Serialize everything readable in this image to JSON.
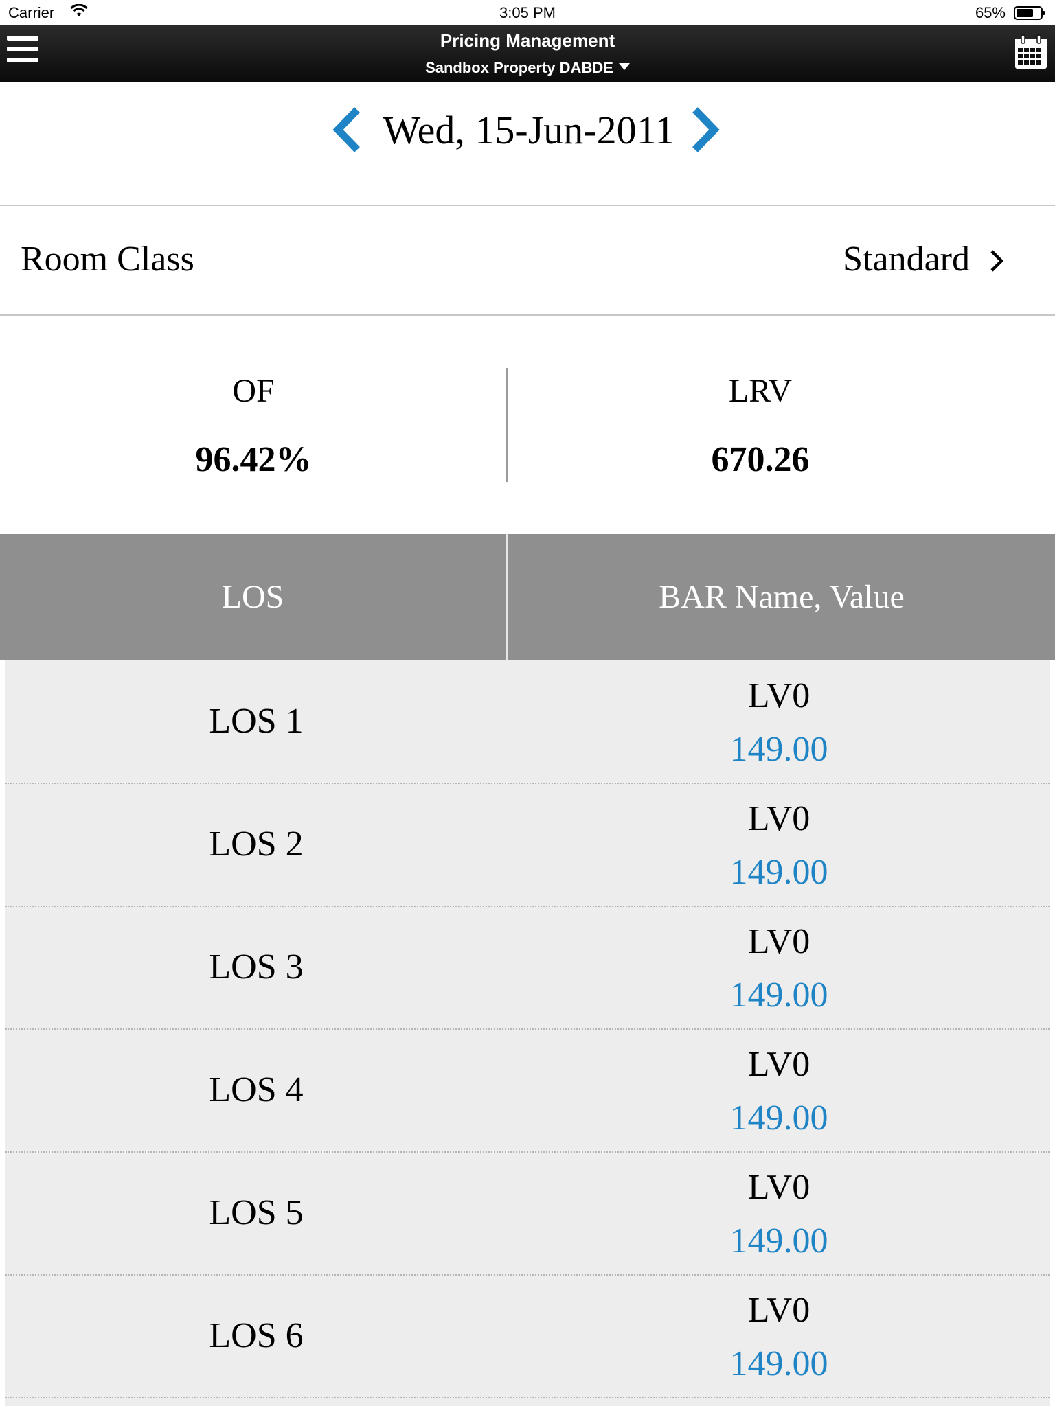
{
  "status_bar": {
    "carrier": "Carrier",
    "time": "3:05 PM",
    "battery": "65%"
  },
  "nav": {
    "title": "Pricing Management",
    "property": "Sandbox Property DABDE"
  },
  "date_nav": {
    "date": "Wed, 15-Jun-2011"
  },
  "room_class": {
    "label": "Room Class",
    "value": "Standard"
  },
  "metrics": {
    "of": {
      "label": "OF",
      "value": "96.42%"
    },
    "lrv": {
      "label": "LRV",
      "value": "670.26"
    }
  },
  "table": {
    "headers": {
      "los": "LOS",
      "bar": "BAR Name, Value"
    },
    "rows": [
      {
        "los": "LOS 1",
        "bar_name": "LV0",
        "value": "149.00"
      },
      {
        "los": "LOS 2",
        "bar_name": "LV0",
        "value": "149.00"
      },
      {
        "los": "LOS 3",
        "bar_name": "LV0",
        "value": "149.00"
      },
      {
        "los": "LOS 4",
        "bar_name": "LV0",
        "value": "149.00"
      },
      {
        "los": "LOS 5",
        "bar_name": "LV0",
        "value": "149.00"
      },
      {
        "los": "LOS 6",
        "bar_name": "LV0",
        "value": "149.00"
      }
    ]
  },
  "colors": {
    "accent": "#1f84c6",
    "header_bg": "#8f8f8f",
    "row_bg": "#ededed",
    "navbar_bg": "#111111"
  }
}
